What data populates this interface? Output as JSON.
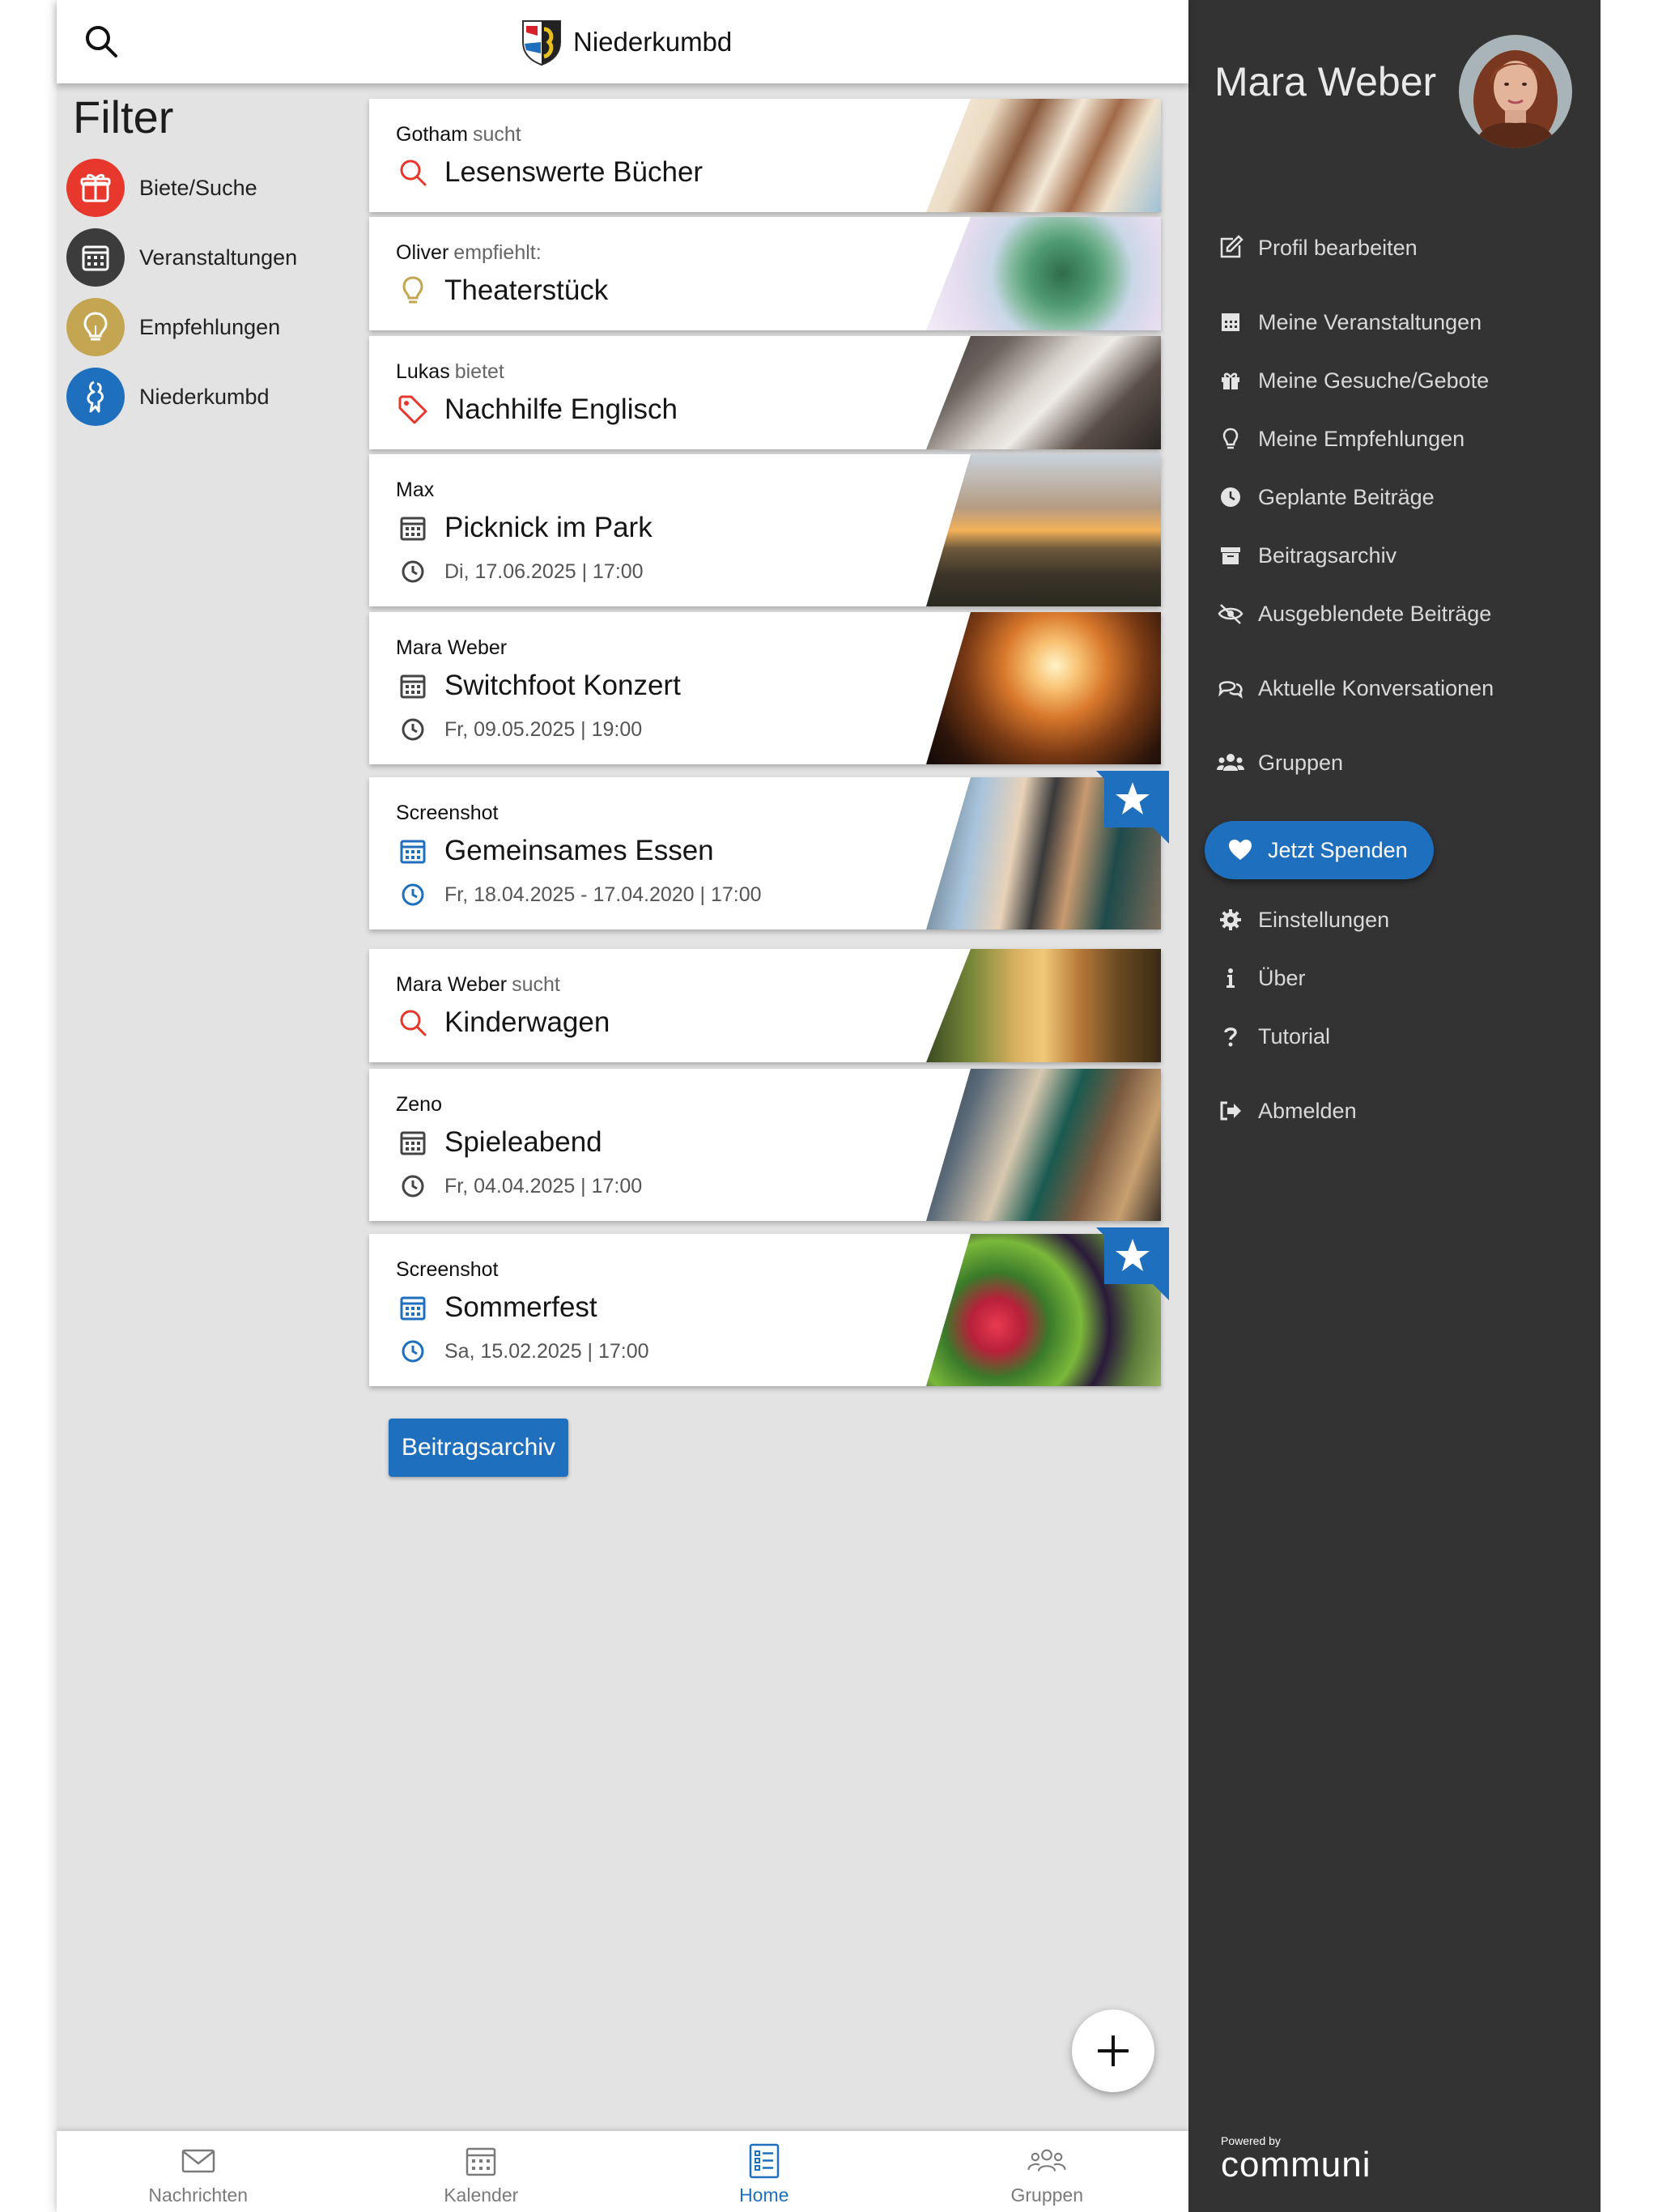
{
  "header": {
    "title": "Niederkumbd"
  },
  "filter": {
    "title": "Filter",
    "items": [
      {
        "label": "Biete/Suche",
        "color": "#e8372c",
        "icon": "gift-icon"
      },
      {
        "label": "Veranstaltungen",
        "color": "#3c3c3c",
        "icon": "calendar-icon"
      },
      {
        "label": "Empfehlungen",
        "color": "#c3a552",
        "icon": "lightbulb-icon"
      },
      {
        "label": "Niederkumbd",
        "color": "#1f6fbf",
        "icon": "crest-icon"
      }
    ]
  },
  "posts": [
    {
      "author": "Gotham",
      "verb": "sucht",
      "title": "Lesenswerte Bücher",
      "icon": "search-icon"
    },
    {
      "author": "Oliver",
      "verb": "empfiehlt:",
      "title": "Theaterstück",
      "icon": "lightbulb-icon"
    },
    {
      "author": "Lukas",
      "verb": "bietet",
      "title": "Nachhilfe Englisch",
      "icon": "tag-icon"
    },
    {
      "author": "Max",
      "verb": "",
      "title": "Picknick im Park",
      "date": "Di, 17.06.2025 | 17:00",
      "icon": "calendar-icon"
    },
    {
      "author": "Mara Weber",
      "verb": "",
      "title": "Switchfoot Konzert",
      "date": "Fr, 09.05.2025 | 19:00",
      "icon": "calendar-icon"
    },
    {
      "author": "Screenshot",
      "verb": "",
      "title": "Gemeinsames Essen",
      "date": "Fr, 18.04.2025 - 17.04.2020 | 17:00",
      "icon": "calendar-icon",
      "featured": true
    },
    {
      "author": "Mara Weber",
      "verb": "sucht",
      "title": "Kinderwagen",
      "icon": "search-icon"
    },
    {
      "author": "Zeno",
      "verb": "",
      "title": "Spieleabend",
      "date": "Fr, 04.04.2025 | 17:00",
      "icon": "calendar-icon"
    },
    {
      "author": "Screenshot",
      "verb": "",
      "title": "Sommerfest",
      "date": "Sa, 15.02.2025 | 17:00",
      "icon": "calendar-icon",
      "featured": true
    }
  ],
  "archive_button": "Beitragsarchiv",
  "bottom_nav": [
    {
      "label": "Nachrichten",
      "icon": "mail-icon"
    },
    {
      "label": "Kalender",
      "icon": "calendar-icon"
    },
    {
      "label": "Home",
      "icon": "list-icon",
      "active": true
    },
    {
      "label": "Gruppen",
      "icon": "users-icon"
    }
  ],
  "sidebar": {
    "user_name": "Mara Weber",
    "menu": [
      {
        "label": "Profil bearbeiten",
        "icon": "edit-icon"
      },
      {
        "label": "Meine Veranstaltungen",
        "icon": "calendar-icon"
      },
      {
        "label": "Meine Gesuche/Gebote",
        "icon": "gift-icon"
      },
      {
        "label": "Meine Empfehlungen",
        "icon": "lightbulb-icon"
      },
      {
        "label": "Geplante Beiträge",
        "icon": "clock-icon"
      },
      {
        "label": "Beitragsarchiv",
        "icon": "archive-icon"
      },
      {
        "label": "Ausgeblendete Beiträge",
        "icon": "eye-slash-icon"
      },
      {
        "label": "Aktuelle Konversationen",
        "icon": "chat-icon"
      },
      {
        "label": "Gruppen",
        "icon": "users-icon"
      },
      {
        "label": "Einstellungen",
        "icon": "gear-icon"
      },
      {
        "label": "Über",
        "icon": "info-icon"
      },
      {
        "label": "Tutorial",
        "icon": "question-icon"
      },
      {
        "label": "Abmelden",
        "icon": "logout-icon"
      }
    ],
    "donate_label": "Jetzt Spenden",
    "powered_by": "Powered by",
    "brand": "communi"
  },
  "colors": {
    "accent": "#1f6fbf",
    "red": "#e8372c",
    "gold": "#c3a552",
    "sidebar_bg": "#333333"
  }
}
